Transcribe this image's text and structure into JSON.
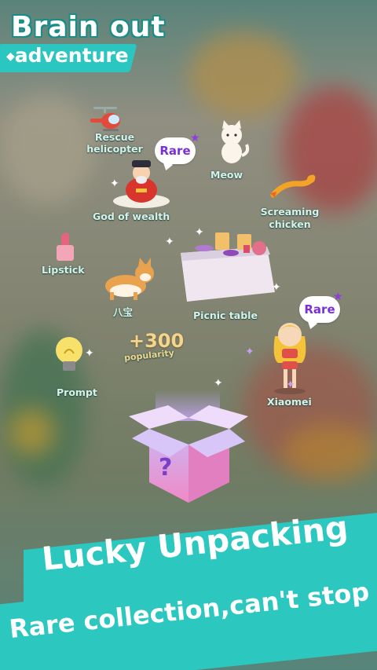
{
  "header": {
    "title": "Brain out",
    "subtitle": "adventure"
  },
  "items": {
    "rescue_helicopter": "Rescue\nhelicopter",
    "meow": "Meow",
    "god_of_wealth": "God of wealth",
    "screaming_chicken": "Screaming\nchicken",
    "lipstick": "Lipstick",
    "dog": "八宝",
    "picnic_table": "Picnic table",
    "prompt": "Prompt",
    "xiaomei": "Xiaomei"
  },
  "badges": {
    "rare_1": "Rare",
    "rare_2": "Rare"
  },
  "reward": {
    "amount": "+300",
    "label": "popularity"
  },
  "box": {
    "symbol": "?"
  },
  "banner": {
    "line1": "Lucky Unpacking",
    "line2": "Rare collection,can't stop"
  },
  "colors": {
    "accent": "#2cc7bf",
    "rare_text": "#7b30d6",
    "label_text": "#d6f2ea"
  }
}
